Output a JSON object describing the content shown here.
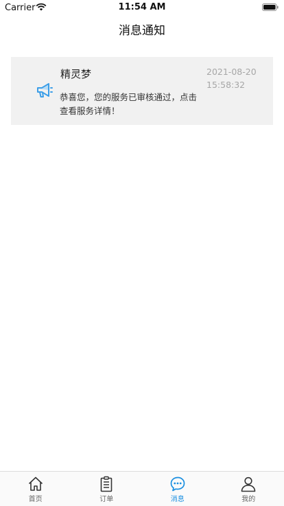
{
  "status_bar": {
    "carrier": "Carrier",
    "time": "11:54 AM"
  },
  "nav": {
    "title": "消息通知"
  },
  "messages": [
    {
      "icon": "megaphone-icon",
      "title": "精灵梦",
      "date": "2021-08-20",
      "time": "15:58:32",
      "body": "恭喜您，您的服务已审核通过，点击查看服务详情！"
    }
  ],
  "tab_bar": {
    "active": "消息",
    "accent_color": "#1a8fe0",
    "tabs": [
      {
        "label": "首页",
        "icon": "home-icon"
      },
      {
        "label": "订单",
        "icon": "clipboard-icon"
      },
      {
        "label": "消息",
        "icon": "chat-bubble-icon"
      },
      {
        "label": "我的",
        "icon": "person-icon"
      }
    ]
  }
}
